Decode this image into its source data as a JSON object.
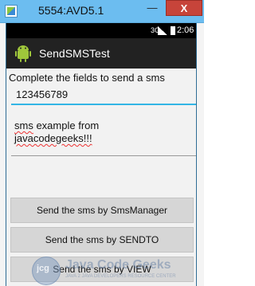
{
  "window": {
    "title": "5554:AVD5.1",
    "minimize_label": "—",
    "close_label": "X"
  },
  "statusbar": {
    "network_label": "3G",
    "time": "2:06"
  },
  "actionbar": {
    "app_name": "SendSMSTest"
  },
  "form": {
    "prompt": "Complete the fields to send a sms",
    "phone_value": "123456789",
    "message_line1_a": "sms",
    "message_line1_b": " example  from",
    "message_line2": "javacodegeeks!!!"
  },
  "buttons": [
    {
      "label": "Send the sms by SmsManager"
    },
    {
      "label": "Send the sms by SENDTO"
    },
    {
      "label": "Send the sms by VIEW"
    }
  ],
  "watermark": {
    "logo_text": "jcg",
    "brand": "Java Code Geeks",
    "tagline": "JAVA 2 JAVA DEVELOPERS RESOURCE CENTER"
  },
  "colors": {
    "titlebar": "#6cbdf0",
    "close_button": "#c7443a",
    "input_focus": "#33b5e5",
    "actionbar": "#222222"
  }
}
